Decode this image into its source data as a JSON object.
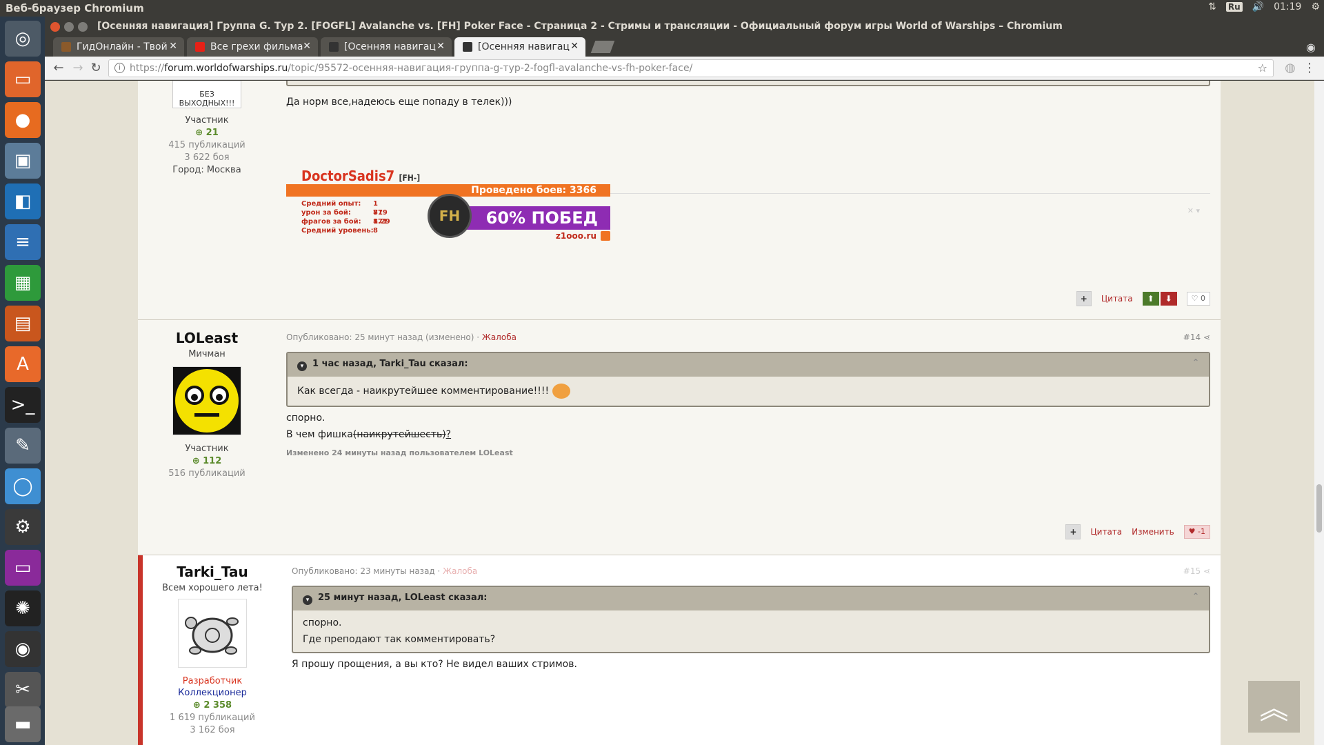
{
  "top_panel": {
    "app_title": "Веб-браузер Chromium",
    "keyboard_layout": "Ru",
    "time": "01:19"
  },
  "window": {
    "title": "[Осенняя навигация] Группа G. Тур 2. [FOGFL] Avalanche vs. [FH] Poker Face - Страница 2 - Стримы и трансляции - Официальный форум игры World of Warships – Chromium"
  },
  "tabs": [
    {
      "label": "ГидОнлайн - Твой",
      "favicon_color": "#8b5a2b",
      "active": false
    },
    {
      "label": "Все грехи фильма",
      "favicon_color": "#e62117",
      "active": false
    },
    {
      "label": "[Осенняя навигац",
      "favicon_color": "#333333",
      "active": false
    },
    {
      "label": "[Осенняя навигац",
      "favicon_color": "#333333",
      "active": true
    }
  ],
  "address": {
    "scheme": "https://",
    "host": "forum.worldofwarships.ru",
    "path": "/topic/95572-осенняя-навигация-группа-g-тур-2-fogfl-avalanche-vs-fh-poker-face/"
  },
  "posts": [
    {
      "id": "p13",
      "author_rank_label": "Участник",
      "reputation": "21",
      "publications": "415 публикаций",
      "battles": "3 622 боя",
      "city": "Город: Москва",
      "text": "Да норм все,надеюсь еще попаду в телек)))",
      "signature": {
        "name": "DoctorSadis7",
        "clan": "[FH-]",
        "battles_label": "Проведено боев: 3366",
        "stats": [
          {
            "label": "Средний опыт:",
            "value": "1 779"
          },
          {
            "label": "урон за бой:",
            "value": "81 871"
          },
          {
            "label": "фрагов за бой:",
            "value": "1.29"
          },
          {
            "label": "Средний уровень:",
            "value": "8"
          }
        ],
        "emblem": "FH",
        "winrate": "60% ПОБЕД",
        "site": "z1ooo.ru"
      },
      "actions": {
        "quote": "Цитата",
        "rep": "0"
      }
    },
    {
      "id": "p14",
      "author": "LOLeast",
      "title": "Мичман",
      "author_rank_label": "Участник",
      "reputation": "112",
      "publications": "516 публикаций",
      "meta": "Опубликовано: 25 минут назад (изменено) · ",
      "report": "Жалоба",
      "number": "#14",
      "quote_head": "1 час назад, Tarki_Tau сказал:",
      "quote_text": "Как всегда - наикрутейшее комментирование!!!!",
      "line1": "спорно.",
      "line2_prefix": "В чем фишка",
      "line2_struck": "(наикрутейшесть)",
      "line2_suffix": "?",
      "edited": "Изменено 24 минуты назад пользователем LOLeast",
      "actions": {
        "quote": "Цитата",
        "edit": "Изменить",
        "rep": "-1"
      }
    },
    {
      "id": "p15",
      "author": "Tarki_Tau",
      "status": "Всем хорошего лета!",
      "role1": "Разработчик",
      "role2": "Коллекционер",
      "reputation": "2 358",
      "publications": "1 619 публикаций",
      "battles": "3 162 боя",
      "meta": "Опубликовано: 23 минуты назад · ",
      "report": "Жалоба",
      "number": "#15",
      "quote_head": "25 минут назад, LOLeast сказал:",
      "quote_line1": "спорно.",
      "quote_line2": "Где преподают так комментировать?",
      "text": "Я прошу прощения, а вы кто? Не видел ваших стримов."
    }
  ],
  "colors": {
    "accent_red": "#b02a2a",
    "positive_green": "#4c7a2a",
    "quote_border": "#8c877a",
    "signature_orange": "#f07322",
    "signature_purple": "#8e2cb3"
  }
}
